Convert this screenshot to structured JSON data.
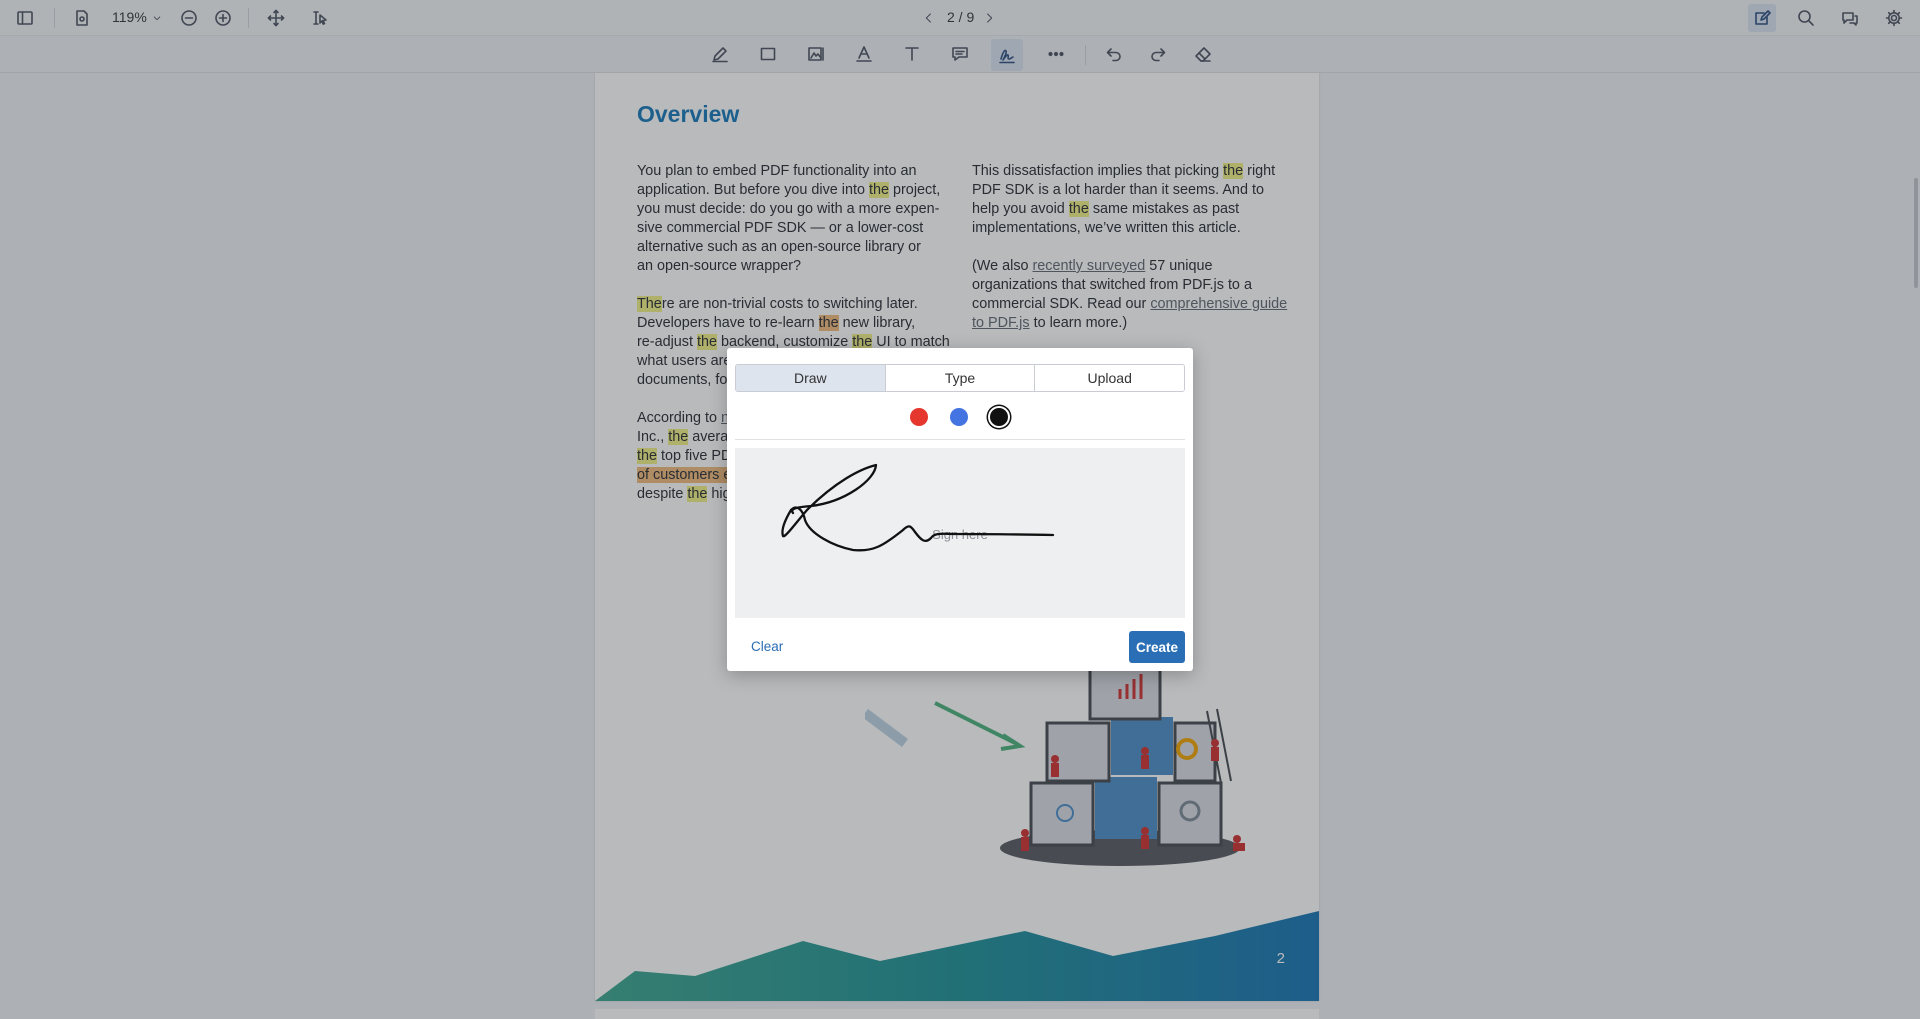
{
  "toolbar": {
    "zoom": "119%",
    "page_indicator": "2 / 9"
  },
  "document": {
    "heading": "Overview",
    "page_number": "2",
    "left_col": {
      "p1": [
        "You plan to embed PDF functionality into an",
        "application. But before you dive into ",
        "the",
        " project,",
        "you must decide: do you go with a more expen-",
        "sive commercial PDF SDK — or a lower-cost",
        "alternative such as an open-source library or",
        "an open-source wrapper?"
      ],
      "p2": [
        "The",
        "re are non-trivial costs to switching later.",
        "Developers have to re-learn ",
        "the",
        " new library,",
        "re-adjust ",
        "the",
        " backend, customize ",
        "the",
        " UI to match",
        "what users are",
        "documents, fo"
      ],
      "p3": [
        "According to ",
        "n",
        "Inc., ",
        "the",
        " averag",
        "the",
        " top five PD",
        "of customers e",
        "despite ",
        "the",
        " hig"
      ]
    },
    "right_col": {
      "p1": [
        "This dissatisfaction implies that picking ",
        "the",
        " right",
        "PDF SDK is a lot harder than it seems. And to",
        "help you avoid ",
        "the",
        " same mistakes as past",
        "implementations, we’ve written this article."
      ],
      "p2": [
        "(We also ",
        "recently surveyed",
        " 57 unique",
        "organizations that switched from PDF.js to a",
        "commercial SDK. Read our ",
        "comprehensive guide ",
        "to PDF.js",
        " to learn more.)"
      ]
    }
  },
  "signature_dialog": {
    "tabs": [
      "Draw",
      "Type",
      "Upload"
    ],
    "active_tab": "Draw",
    "colors": [
      "#e5372e",
      "#4474e1",
      "#111111"
    ],
    "selected_color": "#111111",
    "placeholder": "Sign here",
    "clear_label": "Clear",
    "create_label": "Create"
  }
}
